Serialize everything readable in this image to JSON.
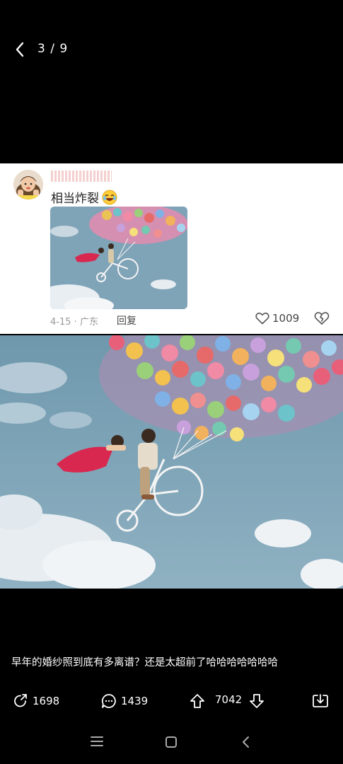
{
  "header": {
    "counter": "3 / 9"
  },
  "comment": {
    "text": "相当炸裂",
    "date": "4-15",
    "location": "广东",
    "reply_label": "回复",
    "like_count": "1009"
  },
  "post": {
    "caption": "早年的婚纱照到底有多离谱？还是太超前了哈哈哈哈哈哈哈"
  },
  "actions": {
    "share_count": "1698",
    "comment_count": "1439",
    "vote_count": "7042"
  },
  "icons": [
    "back-icon",
    "laughing-emoji-icon",
    "heart-icon",
    "broken-heart-icon",
    "share-icon",
    "comment-icon",
    "upvote-icon",
    "downvote-icon",
    "download-icon",
    "menu-icon",
    "home-icon",
    "nav-back-icon"
  ]
}
